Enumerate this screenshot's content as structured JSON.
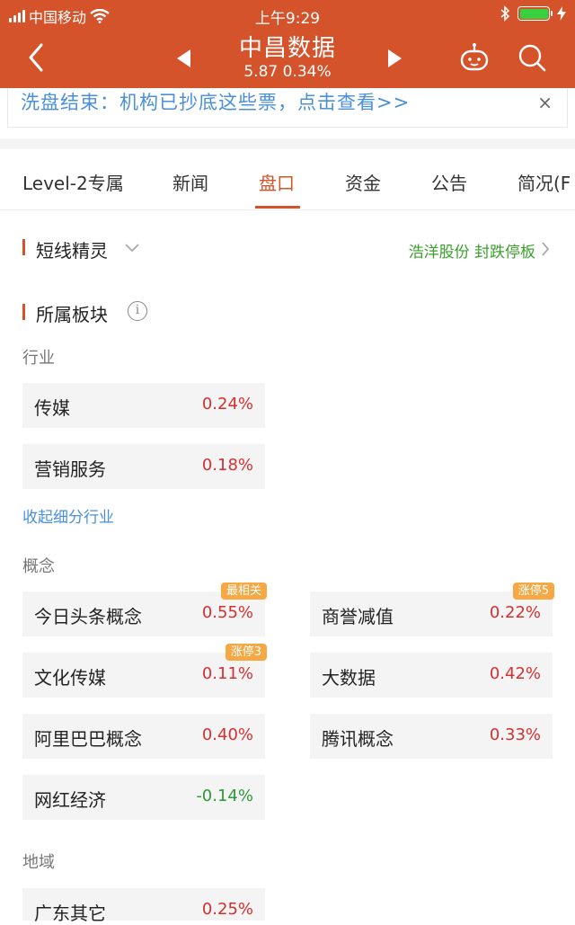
{
  "status_bar": {
    "carrier": "中国移动",
    "time": "上午9:29"
  },
  "header": {
    "title": "中昌数据",
    "price": "5.87",
    "change": "0.34%"
  },
  "banner": {
    "text": "洗盘结束：机构已抄底这些票，点击查看>>",
    "close": "×"
  },
  "tabs": [
    {
      "label": "Level-2专属",
      "active": false
    },
    {
      "label": "新闻",
      "active": false
    },
    {
      "label": "盘口",
      "active": true
    },
    {
      "label": "资金",
      "active": false
    },
    {
      "label": "公告",
      "active": false
    },
    {
      "label": "简况(F",
      "active": false
    }
  ],
  "short_sprite": {
    "title": "短线精灵",
    "latest": "浩洋股份 封跌停板"
  },
  "sectors": {
    "title": "所属板块",
    "info": "i",
    "industry": {
      "label": "行业",
      "items": [
        {
          "name": "传媒",
          "pct": "0.24%",
          "dir": "up"
        },
        {
          "name": "营销服务",
          "pct": "0.18%",
          "dir": "up"
        }
      ],
      "collapse_link": "收起细分行业"
    },
    "concept": {
      "label": "概念",
      "items": [
        {
          "name": "今日头条概念",
          "pct": "0.55%",
          "dir": "up",
          "badge": "最相关"
        },
        {
          "name": "商誉减值",
          "pct": "0.22%",
          "dir": "up",
          "badge": "涨停5"
        },
        {
          "name": "文化传媒",
          "pct": "0.11%",
          "dir": "up",
          "badge": "涨停3"
        },
        {
          "name": "大数据",
          "pct": "0.42%",
          "dir": "up"
        },
        {
          "name": "阿里巴巴概念",
          "pct": "0.40%",
          "dir": "up"
        },
        {
          "name": "腾讯概念",
          "pct": "0.33%",
          "dir": "up"
        },
        {
          "name": "网红经济",
          "pct": "-0.14%",
          "dir": "down"
        }
      ]
    },
    "region": {
      "label": "地域",
      "items": [
        {
          "name": "广东其它",
          "pct": "0.25%",
          "dir": "up"
        }
      ]
    }
  },
  "colors": {
    "brand": "#d4532b",
    "up": "#d43030",
    "down": "#2e9a36",
    "link": "#4a8fd9",
    "badge": "#f5a844"
  }
}
